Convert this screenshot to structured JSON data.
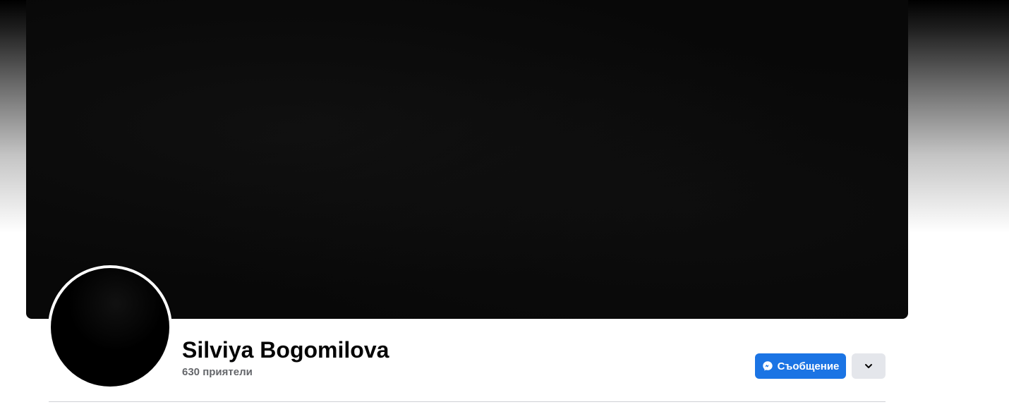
{
  "profile": {
    "name": "Silviya Bogomilova",
    "friends_text": "630 приятели"
  },
  "actions": {
    "message_label": "Съобщение",
    "message_icon": "messenger-icon",
    "more_icon": "chevron-down-icon"
  },
  "colors": {
    "primary_button": "#1b74e4",
    "secondary_button": "#e4e6eb",
    "name_text": "#050505",
    "secondary_text": "#65676b"
  }
}
